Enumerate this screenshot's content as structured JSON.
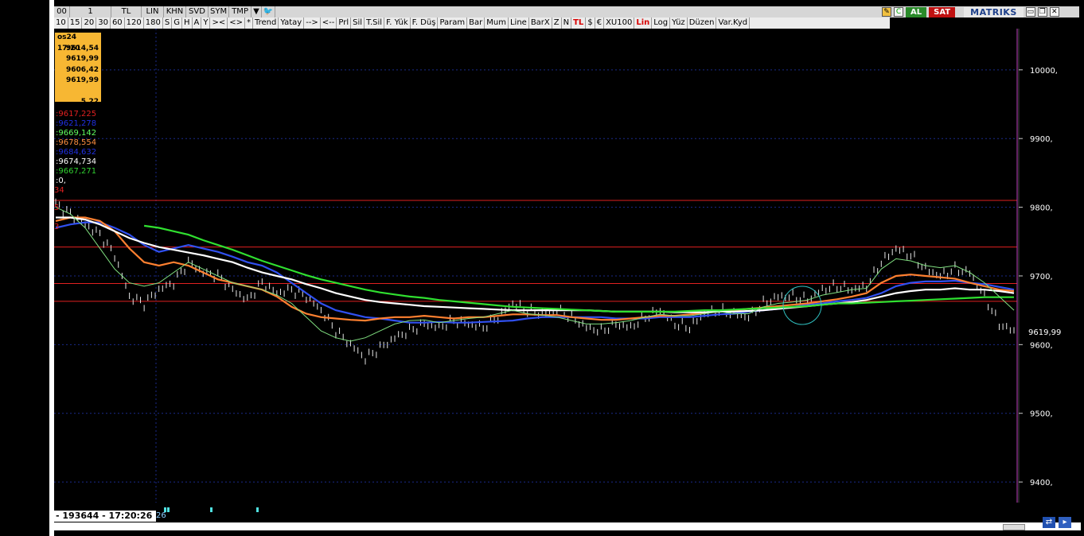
{
  "toolbar1": {
    "items": [
      "00",
      "1",
      "TL",
      "LIN",
      "KHN",
      "SVD",
      "SYM",
      "TMP",
      "▼"
    ],
    "right": {
      "al_label": "AL",
      "sat_label": "SAT",
      "logo": "MATRIKS"
    }
  },
  "toolbar2": {
    "items": [
      "10",
      "15",
      "20",
      "30",
      "60",
      "120",
      "180",
      "S",
      "G",
      "H",
      "A",
      "Y",
      "><",
      "<>",
      "*",
      "Trend",
      "Yatay",
      "-->",
      "<--",
      "Prl",
      "Sil",
      "T.Sil",
      "F. Yük",
      "F. Düş",
      "Param",
      "Bar",
      "Mum",
      "Line",
      "BarX",
      "Z",
      "N",
      "TL",
      "$",
      "€",
      "XU100",
      "Lin",
      "Log",
      "Yüz",
      "Düzen",
      "Var.Kyd"
    ],
    "red_items": [
      "TL",
      "Lin"
    ]
  },
  "infobox": {
    "date": "os24 17:20",
    "open": "9614,54",
    "high": "9619,99",
    "low": "9606,42",
    "close": "9619,99",
    "blank": "",
    "change": "5,22"
  },
  "indicator_values": [
    {
      "text": ":9617,225",
      "color": "#e02020"
    },
    {
      "text": ":9621,278",
      "color": "#2030e0"
    },
    {
      "text": ":9669,142",
      "color": "#60ff60"
    },
    {
      "text": ":9678,554",
      "color": "#ff9040"
    },
    {
      "text": ":9684,632",
      "color": "#2030e0"
    },
    {
      "text": ":9674,734",
      "color": "#ffffff"
    },
    {
      "text": ":9667,271",
      "color": "#30d030"
    },
    {
      "text": ":0,",
      "color": "#ffffff"
    }
  ],
  "left_edge_labels": {
    "l1": "34",
    "l2": "5",
    "l3": "3"
  },
  "status": {
    "time_text": "- 193644 - 17:20:26",
    "day": "26"
  },
  "chart_data": {
    "type": "line",
    "y_ticks": [
      "10000,",
      "9900,",
      "9800,",
      "9700,",
      "9600,",
      "9500,",
      "9400,"
    ],
    "y_tick_values": [
      10000,
      9900,
      9800,
      9700,
      9600,
      9500,
      9400
    ],
    "last_price_label": "9619,99",
    "ylim": [
      9370,
      10060
    ],
    "horizontal_levels": [
      9810,
      9742,
      9689,
      9663
    ],
    "series": [
      {
        "color": "#e6e6e6",
        "kind": "price",
        "values": [
          9805,
          9790,
          9775,
          9760,
          9730,
          9670,
          9660,
          9680,
          9690,
          9720,
          9705,
          9700,
          9680,
          9665,
          9690,
          9675,
          9680,
          9670,
          9650,
          9620,
          9600,
          9580,
          9595,
          9610,
          9620,
          9630,
          9625,
          9635,
          9630,
          9625,
          9640,
          9660,
          9650,
          9645,
          9650,
          9640,
          9625,
          9620,
          9630,
          9625,
          9640,
          9650,
          9630,
          9625,
          9645,
          9650,
          9645,
          9640,
          9660,
          9670,
          9670,
          9665,
          9680,
          9685,
          9680,
          9685,
          9720,
          9740,
          9730,
          9710,
          9700,
          9710,
          9705,
          9670,
          9630,
          9619
        ]
      },
      {
        "color": "#3050f0",
        "kind": "ma",
        "values": [
          9770,
          9775,
          9778,
          9778,
          9770,
          9760,
          9745,
          9735,
          9740,
          9745,
          9740,
          9735,
          9728,
          9720,
          9715,
          9705,
          9690,
          9675,
          9660,
          9650,
          9645,
          9640,
          9638,
          9635,
          9632,
          9632,
          9633,
          9632,
          9632,
          9633,
          9634,
          9635,
          9638,
          9640,
          9640,
          9640,
          9640,
          9640,
          9638,
          9638,
          9638,
          9640,
          9640,
          9640,
          9642,
          9644,
          9645,
          9648,
          9650,
          9652,
          9655,
          9658,
          9660,
          9663,
          9665,
          9668,
          9675,
          9685,
          9690,
          9692,
          9692,
          9693,
          9690,
          9688,
          9684,
          9680
        ]
      },
      {
        "color": "#ff8030",
        "kind": "ma",
        "values": [
          9780,
          9785,
          9785,
          9780,
          9765,
          9740,
          9720,
          9715,
          9720,
          9715,
          9705,
          9695,
          9690,
          9685,
          9680,
          9670,
          9655,
          9645,
          9640,
          9638,
          9636,
          9635,
          9638,
          9640,
          9640,
          9642,
          9640,
          9638,
          9640,
          9640,
          9642,
          9644,
          9644,
          9643,
          9643,
          9640,
          9638,
          9636,
          9636,
          9638,
          9640,
          9642,
          9642,
          9644,
          9646,
          9648,
          9650,
          9652,
          9654,
          9656,
          9658,
          9660,
          9663,
          9666,
          9670,
          9675,
          9690,
          9700,
          9702,
          9700,
          9698,
          9696,
          9690,
          9685,
          9680,
          9678
        ]
      },
      {
        "color": "#ffffff",
        "kind": "ma",
        "values": [
          9785,
          9785,
          9782,
          9775,
          9765,
          9755,
          9748,
          9742,
          9738,
          9734,
          9730,
          9725,
          9720,
          9712,
          9705,
          9700,
          9695,
          9688,
          9682,
          9675,
          9670,
          9665,
          9662,
          9660,
          9658,
          9656,
          9655,
          9654,
          9653,
          9652,
          9651,
          9650,
          9650,
          9650,
          9650,
          9650,
          9650,
          9649,
          9648,
          9648,
          9648,
          9648,
          9647,
          9647,
          9647,
          9648,
          9648,
          9649,
          9650,
          9652,
          9654,
          9656,
          9658,
          9660,
          9662,
          9665,
          9670,
          9675,
          9678,
          9680,
          9680,
          9682,
          9680,
          9680,
          9678,
          9675
        ]
      },
      {
        "color": "#30e030",
        "kind": "ma",
        "start": 6,
        "values": [
          null,
          null,
          null,
          null,
          null,
          null,
          9773,
          9770,
          9765,
          9760,
          9752,
          9745,
          9738,
          9730,
          9722,
          9715,
          9708,
          9701,
          9695,
          9690,
          9685,
          9680,
          9676,
          9673,
          9670,
          9668,
          9665,
          9663,
          9661,
          9659,
          9657,
          9655,
          9654,
          9653,
          9652,
          9651,
          9650,
          9649,
          9648,
          9648,
          9648,
          9648,
          9648,
          9649,
          9650,
          9650,
          9651,
          9652,
          9653,
          9654,
          9655,
          9656,
          9658,
          9660,
          9660,
          9661,
          9662,
          9663,
          9664,
          9665,
          9666,
          9667,
          9668,
          9669,
          9669,
          9669
        ]
      },
      {
        "color": "#80e080",
        "kind": "ma_thin",
        "values": [
          9800,
          9790,
          9770,
          9740,
          9710,
          9690,
          9685,
          9690,
          9705,
          9720,
          9710,
          9700,
          9690,
          9685,
          9680,
          9672,
          9660,
          9640,
          9620,
          9610,
          9605,
          9610,
          9620,
          9630,
          9635,
          9636,
          9632,
          9635,
          9638,
          9640,
          9645,
          9650,
          9645,
          9643,
          9640,
          9635,
          9630,
          9630,
          9632,
          9635,
          9640,
          9644,
          9642,
          9642,
          9645,
          9648,
          9645,
          9645,
          9655,
          9660,
          9662,
          9665,
          9672,
          9676,
          9680,
          9682,
          9710,
          9725,
          9722,
          9715,
          9712,
          9715,
          9705,
          9690,
          9670,
          9650
        ]
      }
    ]
  }
}
